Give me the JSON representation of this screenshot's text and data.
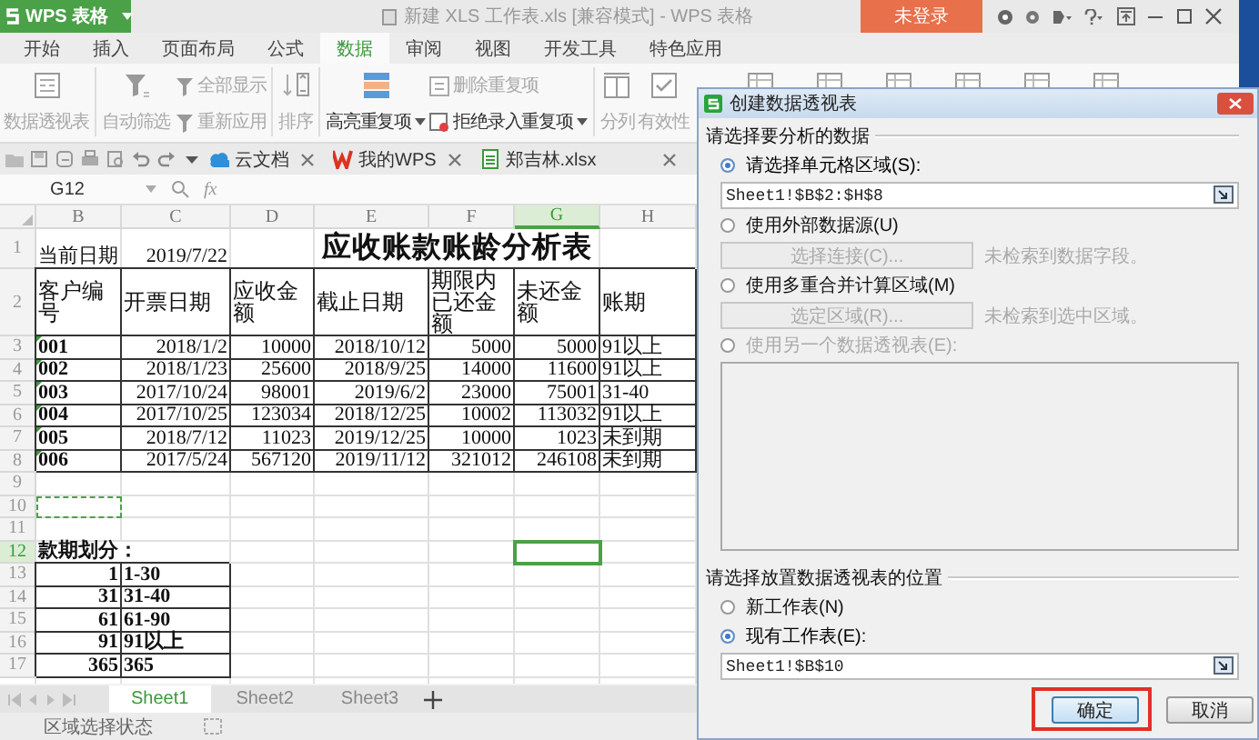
{
  "app": {
    "brand": "WPS 表格",
    "title": "新建 XLS 工作表.xls [兼容模式] - WPS 表格",
    "login": "未登录"
  },
  "menu_tabs": [
    {
      "label": "开始",
      "selected": false
    },
    {
      "label": "插入",
      "selected": false
    },
    {
      "label": "页面布局",
      "selected": false
    },
    {
      "label": "公式",
      "selected": false
    },
    {
      "label": "数据",
      "selected": true
    },
    {
      "label": "审阅",
      "selected": false
    },
    {
      "label": "视图",
      "selected": false
    },
    {
      "label": "开发工具",
      "selected": false
    },
    {
      "label": "特色应用",
      "selected": false
    }
  ],
  "ribbon": [
    {
      "kind": "big",
      "label": "数据透视表",
      "disabled": true,
      "dropdown": false
    },
    {
      "kind": "big",
      "label": "自动筛选",
      "disabled": true,
      "dropdown": false
    },
    {
      "kind": "stack",
      "rows": [
        {
          "label": "全部显示",
          "disabled": true,
          "dropdown": false
        },
        {
          "label": "重新应用",
          "disabled": true,
          "dropdown": false
        }
      ]
    },
    {
      "kind": "big",
      "label": "排序",
      "disabled": true,
      "dropdown": false
    },
    {
      "kind": "big",
      "label": "高亮重复项",
      "disabled": false,
      "dropdown": true
    },
    {
      "kind": "stack",
      "rows": [
        {
          "label": "删除重复项",
          "disabled": true,
          "dropdown": false
        },
        {
          "label": "拒绝录入重复项",
          "disabled": false,
          "dropdown": true
        }
      ]
    },
    {
      "kind": "big",
      "label": "分列",
      "disabled": true,
      "dropdown": false
    },
    {
      "kind": "big",
      "label": "有效性",
      "disabled": true,
      "dropdown": false
    }
  ],
  "doc_tabs": [
    {
      "label": "云文档"
    },
    {
      "label": "我的WPS"
    },
    {
      "label": "郑吉林.xlsx"
    }
  ],
  "formula_bar": {
    "cell_ref": "G12",
    "function_label": "fx"
  },
  "sheet": {
    "columns": [
      {
        "label": "B",
        "selected": false
      },
      {
        "label": "C",
        "selected": false
      },
      {
        "label": "D",
        "selected": false
      },
      {
        "label": "E",
        "selected": false
      },
      {
        "label": "F",
        "selected": false
      },
      {
        "label": "G",
        "selected": true
      },
      {
        "label": "H",
        "selected": false
      }
    ],
    "rows": [
      {
        "number": "1",
        "kind": "title",
        "selected": false,
        "boxed": false,
        "cells": [
          {
            "text": "当前日期",
            "kind": "text"
          },
          {
            "text": "2019/7/22",
            "kind": "number"
          },
          null,
          {
            "text": "应收账款账龄分析表",
            "kind": "title"
          }
        ]
      },
      {
        "number": "2",
        "kind": "header",
        "selected": false,
        "boxed": true,
        "cells": [
          {
            "text": "客户编号",
            "kind": "header"
          },
          {
            "text": "开票日期",
            "kind": "header"
          },
          {
            "text": "应收金额",
            "kind": "header"
          },
          {
            "text": "截止日期",
            "kind": "header"
          },
          {
            "text": "期限内已还金额",
            "kind": "header"
          },
          {
            "text": "未还金额",
            "kind": "header"
          },
          {
            "text": "账期",
            "kind": "header"
          }
        ]
      },
      {
        "number": "3",
        "kind": "data",
        "selected": false,
        "boxed": true,
        "cells": [
          {
            "text": "001",
            "kind": "code"
          },
          {
            "text": "2018/1/2",
            "kind": "number"
          },
          {
            "text": "10000",
            "kind": "number"
          },
          {
            "text": "2018/10/12",
            "kind": "number"
          },
          {
            "text": "5000",
            "kind": "number"
          },
          {
            "text": "5000",
            "kind": "number"
          },
          {
            "text": "91以上",
            "kind": "text"
          }
        ]
      },
      {
        "number": "4",
        "kind": "data",
        "selected": false,
        "boxed": true,
        "cells": [
          {
            "text": "002",
            "kind": "code"
          },
          {
            "text": "2018/1/23",
            "kind": "number"
          },
          {
            "text": "25600",
            "kind": "number"
          },
          {
            "text": "2018/9/25",
            "kind": "number"
          },
          {
            "text": "14000",
            "kind": "number"
          },
          {
            "text": "11600",
            "kind": "number"
          },
          {
            "text": "91以上",
            "kind": "text"
          }
        ]
      },
      {
        "number": "5",
        "kind": "data",
        "selected": false,
        "boxed": true,
        "cells": [
          {
            "text": "003",
            "kind": "code"
          },
          {
            "text": "2017/10/24",
            "kind": "number"
          },
          {
            "text": "98001",
            "kind": "number"
          },
          {
            "text": "2019/6/2",
            "kind": "number"
          },
          {
            "text": "23000",
            "kind": "number"
          },
          {
            "text": "75001",
            "kind": "number"
          },
          {
            "text": "31-40",
            "kind": "text"
          }
        ]
      },
      {
        "number": "6",
        "kind": "data",
        "selected": false,
        "boxed": true,
        "cells": [
          {
            "text": "004",
            "kind": "code"
          },
          {
            "text": "2017/10/25",
            "kind": "number"
          },
          {
            "text": "123034",
            "kind": "number"
          },
          {
            "text": "2018/12/25",
            "kind": "number"
          },
          {
            "text": "10002",
            "kind": "number"
          },
          {
            "text": "113032",
            "kind": "number"
          },
          {
            "text": "91以上",
            "kind": "text"
          }
        ]
      },
      {
        "number": "7",
        "kind": "data",
        "selected": false,
        "boxed": true,
        "cells": [
          {
            "text": "005",
            "kind": "code"
          },
          {
            "text": "2018/7/12",
            "kind": "number"
          },
          {
            "text": "11023",
            "kind": "number"
          },
          {
            "text": "2019/12/25",
            "kind": "number"
          },
          {
            "text": "10000",
            "kind": "number"
          },
          {
            "text": "1023",
            "kind": "number"
          },
          {
            "text": "未到期",
            "kind": "text"
          }
        ]
      },
      {
        "number": "8",
        "kind": "data",
        "selected": false,
        "boxed": true,
        "cells": [
          {
            "text": "006",
            "kind": "code"
          },
          {
            "text": "2017/5/24",
            "kind": "number"
          },
          {
            "text": "567120",
            "kind": "number"
          },
          {
            "text": "2019/11/12",
            "kind": "number"
          },
          {
            "text": "321012",
            "kind": "number"
          },
          {
            "text": "246108",
            "kind": "number"
          },
          {
            "text": "未到期",
            "kind": "text"
          }
        ]
      },
      {
        "number": "9",
        "kind": "data",
        "selected": false,
        "cells": []
      },
      {
        "number": "10",
        "kind": "data",
        "selected": false,
        "cells": [
          {
            "marquee": true
          }
        ]
      },
      {
        "number": "11",
        "kind": "data",
        "selected": false,
        "cells": []
      },
      {
        "number": "12",
        "kind": "data",
        "selected": true,
        "boxed": false,
        "cells": [
          {
            "text": "款期划分：",
            "kind": "bold-text"
          },
          null,
          null,
          null,
          null,
          {
            "cursor": true
          }
        ]
      },
      {
        "number": "13",
        "kind": "data",
        "selected": false,
        "boxed": true,
        "cells": [
          {
            "text": "1",
            "kind": "bold-number"
          },
          {
            "text": "1-30",
            "kind": "bold-text"
          }
        ]
      },
      {
        "number": "14",
        "kind": "data",
        "selected": false,
        "boxed": true,
        "cells": [
          {
            "text": "31",
            "kind": "bold-number"
          },
          {
            "text": "31-40",
            "kind": "bold-text"
          }
        ]
      },
      {
        "number": "15",
        "kind": "data",
        "selected": false,
        "boxed": true,
        "cells": [
          {
            "text": "61",
            "kind": "bold-number"
          },
          {
            "text": "61-90",
            "kind": "bold-text"
          }
        ]
      },
      {
        "number": "16",
        "kind": "data",
        "selected": false,
        "boxed": true,
        "cells": [
          {
            "text": "91",
            "kind": "bold-number"
          },
          {
            "text": "91以上",
            "kind": "bold-text"
          }
        ]
      },
      {
        "number": "17",
        "kind": "data",
        "selected": false,
        "boxed": true,
        "cells": [
          {
            "text": "365",
            "kind": "bold-number"
          },
          {
            "text": "365",
            "kind": "bold-text"
          }
        ]
      }
    ]
  },
  "sheet_tabs": [
    {
      "label": "Sheet1",
      "selected": true
    },
    {
      "label": "Sheet2",
      "selected": false
    },
    {
      "label": "Sheet3",
      "selected": false
    }
  ],
  "status_bar": {
    "text": "区域选择状态"
  },
  "dialog": {
    "title": "创建数据透视表",
    "source": {
      "heading": "请选择要分析的数据",
      "options": [
        {
          "kind": "range",
          "label": "请选择单元格区域(S):",
          "selected": true,
          "disabled": false,
          "value": "Sheet1!$B$2:$H$8"
        },
        {
          "kind": "connection",
          "label": "使用外部数据源(U)",
          "selected": false,
          "disabled": false,
          "button": "选择连接(C)...",
          "note": "未检索到数据字段。"
        },
        {
          "kind": "connection",
          "label": "使用多重合并计算区域(M)",
          "selected": false,
          "disabled": false,
          "button": "选定区域(R)...",
          "note": "未检索到选中区域。"
        },
        {
          "kind": "list",
          "label": "使用另一个数据透视表(E):",
          "selected": false,
          "disabled": true
        }
      ]
    },
    "destination": {
      "heading": "请选择放置数据透视表的位置",
      "options": [
        {
          "label": "新工作表(N)",
          "selected": false
        },
        {
          "label": "现有工作表(E):",
          "selected": true
        }
      ],
      "value": "Sheet1!$B$10"
    },
    "buttons": [
      {
        "label": "确定",
        "kind": "primary",
        "highlighted": true
      },
      {
        "label": "取消",
        "kind": "default",
        "highlighted": false
      }
    ]
  }
}
